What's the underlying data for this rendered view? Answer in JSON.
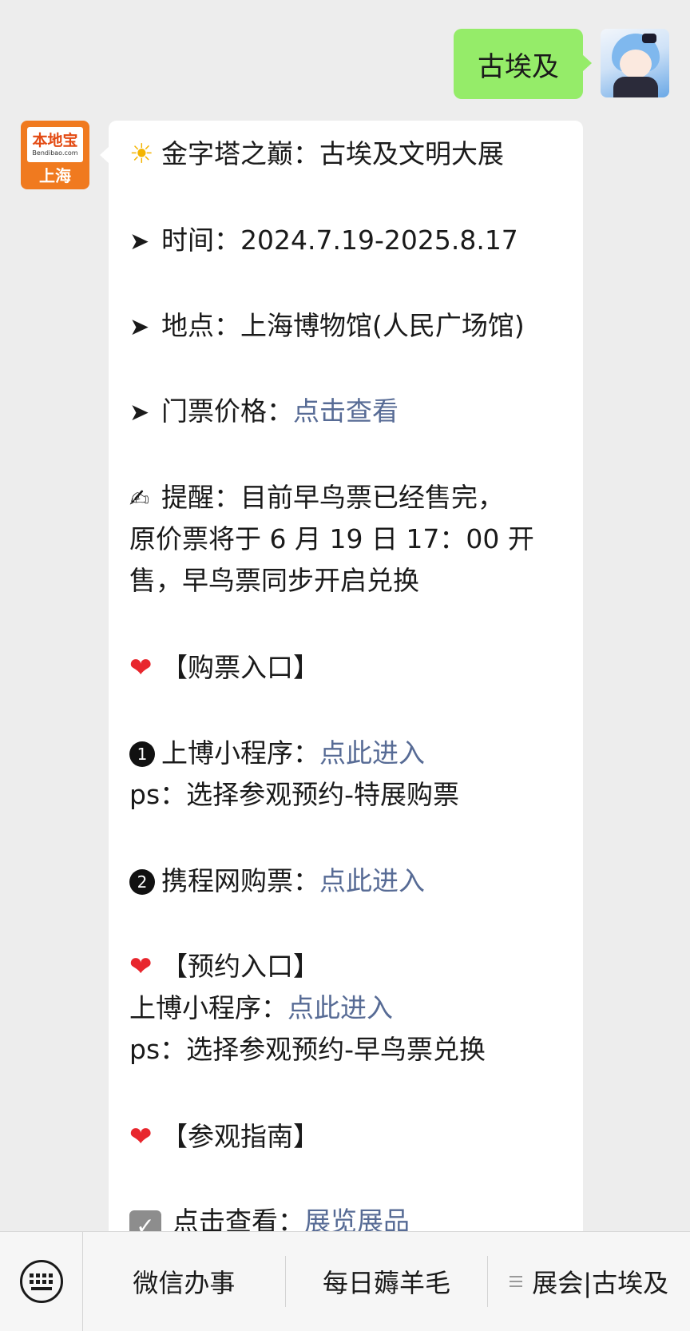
{
  "sent_message": {
    "text": "古埃及"
  },
  "reply": {
    "account": {
      "logo_text": "本地宝",
      "logo_domain": "Bendibao.com",
      "city": "上海"
    },
    "lines": {
      "title": "金字塔之巅：古埃及文明大展",
      "time_label": "时间：",
      "time_value": "2024.7.19-2025.8.17",
      "place_label": "地点：",
      "place_value": "上海博物馆(人民广场馆)",
      "price_label": "门票价格：",
      "price_link": "点击查看",
      "reminder_line1": "提醒：目前早鸟票已经售完，",
      "reminder_line2": "原价票将于 6 月 19 日 17：00 开",
      "reminder_line3": "售，早鸟票同步开启兑换",
      "buy_heading": "【购票入口】",
      "buy1_num": "1",
      "buy1_label": "上博小程序：",
      "buy1_link": "点此进入",
      "buy1_note": "ps：选择参观预约-特展购票",
      "buy2_num": "2",
      "buy2_label": "携程网购票：",
      "buy2_link": "点此进入",
      "reserve_heading": "【预约入口】",
      "reserve_label": "上博小程序：",
      "reserve_link": "点此进入",
      "reserve_note": "ps：选择参观预约-早鸟票兑换",
      "guide_heading": "【参观指南】",
      "guide_label": "点击查看：",
      "guide_link": "展览展品"
    }
  },
  "bottom_menu": {
    "keyboard_icon": "keyboard-icon",
    "items": [
      "微信办事",
      "每日薅羊毛",
      "展会|古埃及"
    ]
  },
  "icons": {
    "bullet": "arrow-right-icon",
    "title": "sun-icon",
    "reminder": "writing-hand-icon",
    "section": "heart-icon",
    "guide": "checkbox-icon"
  },
  "colors": {
    "chat_background": "#ededed",
    "sent_bubble": "#95ec69",
    "received_bubble": "#ffffff",
    "link": "#576b95",
    "brand_orange": "#f07a1f",
    "heart": "#e8262d"
  }
}
